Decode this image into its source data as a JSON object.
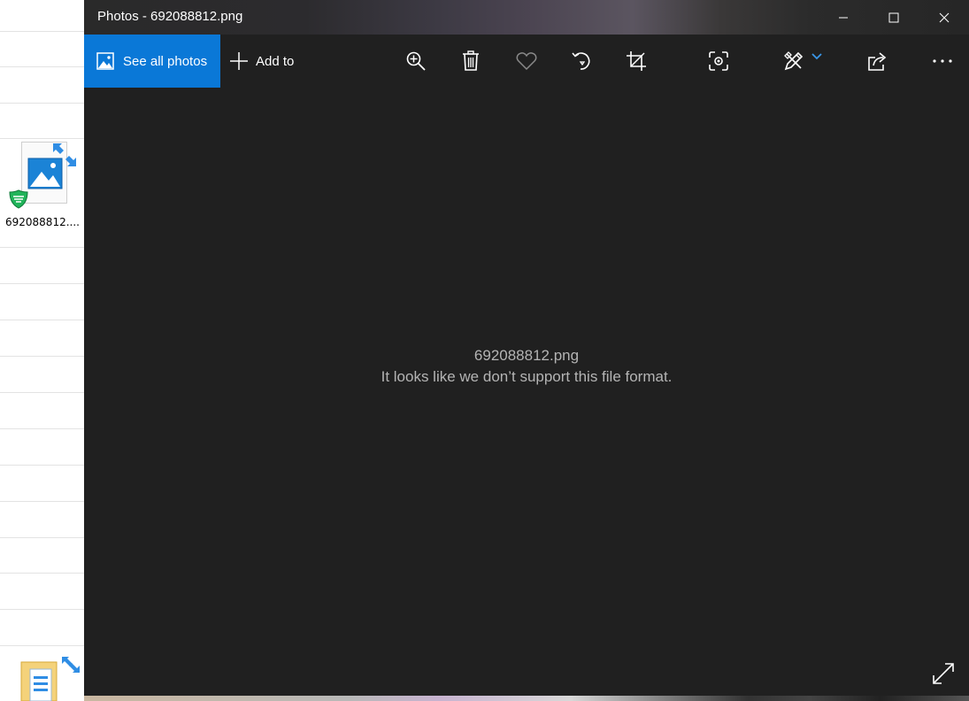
{
  "desktop": {
    "file_label": "692088812....",
    "icons": {
      "file": "image-file-icon",
      "shortcut": "shortcut-arrow-icon",
      "antivirus": "shield-icon",
      "folder": "folder-icon"
    }
  },
  "window": {
    "title": "Photos - 692088812.png",
    "controls": {
      "minimize": "minimize-icon",
      "maximize": "maximize-icon",
      "close": "close-icon"
    }
  },
  "toolbar": {
    "see_all_label": "See all photos",
    "add_to_label": "Add to",
    "tools": [
      "zoom-in-icon",
      "delete-icon",
      "heart-icon",
      "rotate-icon",
      "crop-icon",
      "live-capture-icon",
      "edit-draw-icon",
      "share-icon",
      "more-icon"
    ]
  },
  "viewer": {
    "filename": "692088812.png",
    "message": "It looks like we don’t support this file format.",
    "fullscreen": "fullscreen-icon"
  },
  "colors": {
    "accent": "#0a78d7",
    "window_bg": "#202020",
    "message_text": "#b4b4b4"
  }
}
